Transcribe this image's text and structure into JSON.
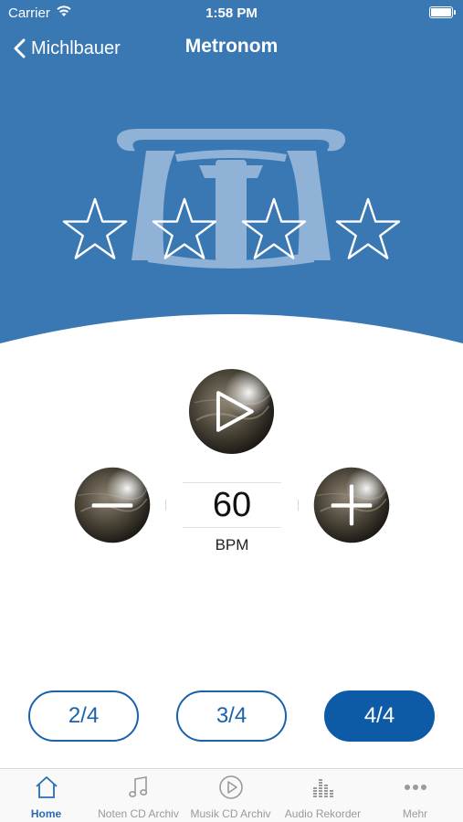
{
  "statusbar": {
    "carrier": "Carrier",
    "time": "1:58 PM"
  },
  "navbar": {
    "back_label": "Michlbauer",
    "title": "Metronom"
  },
  "metronome": {
    "bpm_value": "60",
    "bpm_unit": "BPM",
    "beat_stars_count": 4,
    "time_signatures": [
      {
        "label": "2/4",
        "selected": false
      },
      {
        "label": "3/4",
        "selected": false
      },
      {
        "label": "4/4",
        "selected": true
      }
    ]
  },
  "tabs": [
    {
      "label": "Home",
      "icon": "home-icon",
      "active": true
    },
    {
      "label": "Noten CD Archiv",
      "icon": "music-note-icon",
      "active": false
    },
    {
      "label": "Musik CD Archiv",
      "icon": "play-circle-icon",
      "active": false
    },
    {
      "label": "Audio Rekorder",
      "icon": "equalizer-icon",
      "active": false
    },
    {
      "label": "Mehr",
      "icon": "more-icon",
      "active": false
    }
  ],
  "colors": {
    "header_blue": "#3a78b4",
    "accent_blue": "#1b62a8",
    "active_tab": "#2a6cb4"
  }
}
